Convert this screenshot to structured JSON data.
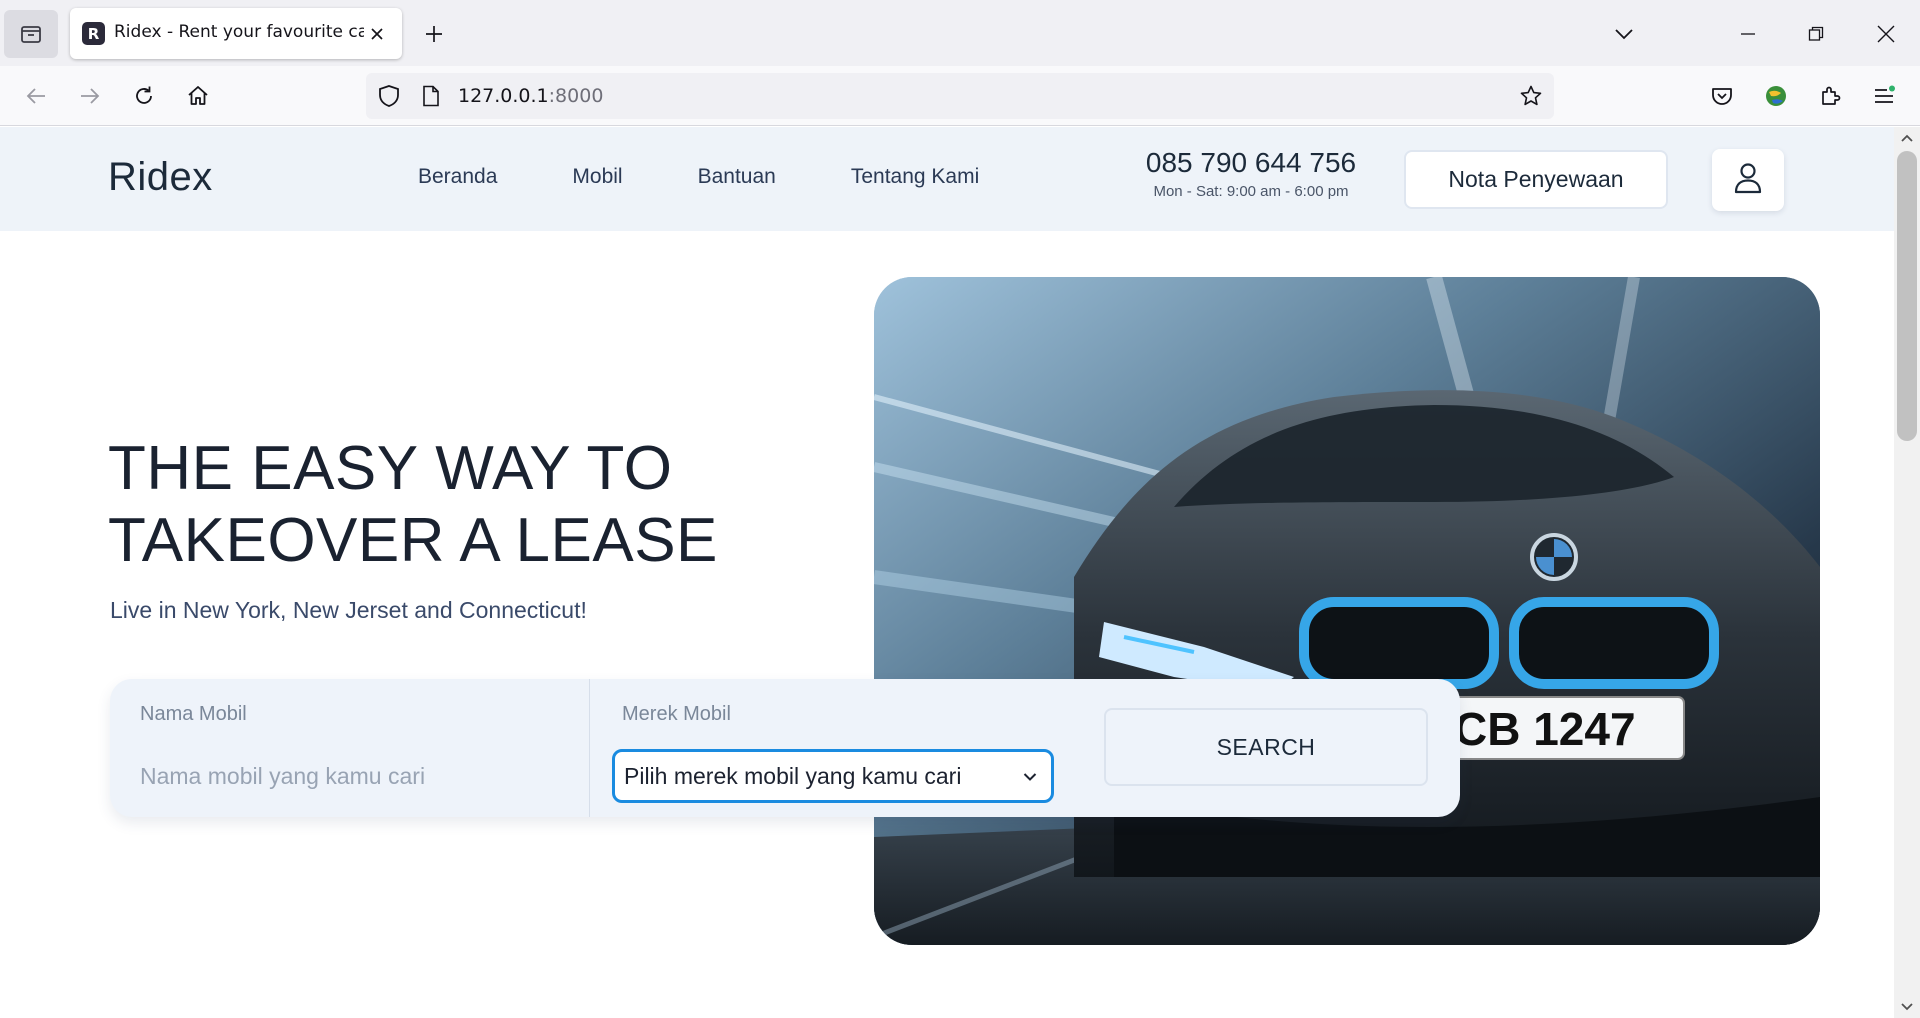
{
  "browser": {
    "tab": {
      "favicon_letter": "R",
      "title": "Ridex - Rent your favourite car"
    },
    "url": {
      "host": "127.0.0.1",
      "port": ":8000"
    },
    "icons": [
      "tab-overview-icon",
      "close-icon",
      "plus-icon",
      "chevron-down-icon",
      "minimize-icon",
      "restore-icon",
      "window-close-icon",
      "back-icon",
      "forward-icon",
      "reload-icon",
      "home-icon",
      "shield-icon",
      "page-icon",
      "star-icon",
      "pocket-icon",
      "extension-globe-icon",
      "extensions-puzzle-icon",
      "menu-icon"
    ]
  },
  "site": {
    "logo": "Ridex",
    "menu": {
      "beranda": "Beranda",
      "mobil": "Mobil",
      "bantuan": "Bantuan",
      "tentang": "Tentang Kami"
    },
    "contact": {
      "phone": "085 790 644 756",
      "hours": "Mon - Sat: 9:00 am - 6:00 pm"
    },
    "nota_button": "Nota Penyewaan",
    "user_icon": "user-icon"
  },
  "hero": {
    "title_line1": "THE EASY WAY TO",
    "title_line2": "TAKEOVER A LEASE",
    "subtitle": "Live in New York, New Jerset and Connecticut!",
    "image": "car-photo"
  },
  "search": {
    "name_label": "Nama Mobil",
    "name_placeholder": "Nama mobil yang kamu cari",
    "brand_label": "Merek Mobil",
    "brand_selected": "Pilih merek mobil yang kamu cari",
    "button": "SEARCH"
  },
  "colors": {
    "header_bg": "#eef3f9",
    "text_dark": "#1a2230",
    "select_focus": "#1a8be0",
    "search_box_bg": "#eef3fa"
  }
}
